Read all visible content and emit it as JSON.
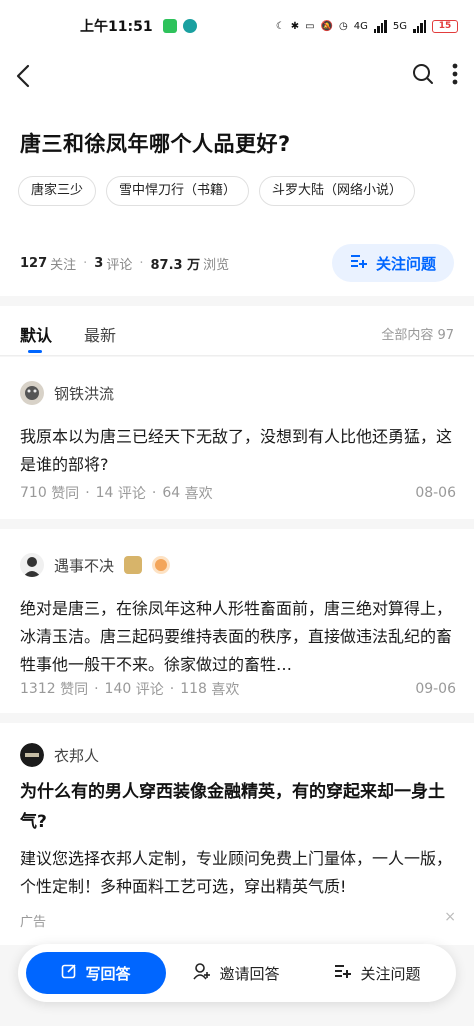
{
  "status": {
    "time": "上午11:51",
    "network_left": "4G",
    "network_right": "5G",
    "battery": "15"
  },
  "question": {
    "title": "唐三和徐凤年哪个人品更好?",
    "tags": [
      "唐家三少",
      "雪中悍刀行（书籍）",
      "斗罗大陆（网络小说）"
    ],
    "followers": "127",
    "followers_label": "关注",
    "comments": "3",
    "comments_label": "评论",
    "views": "87.3 万",
    "views_label": "浏览",
    "follow_button": "关注问题"
  },
  "tabs": {
    "default": "默认",
    "latest": "最新",
    "total": "全部内容 97"
  },
  "answers": [
    {
      "author": "钢铁洪流",
      "text": "我原本以为唐三已经天下无敌了，没想到有人比他还勇猛，这是谁的部将?",
      "likes": "710",
      "likes_label": "赞同",
      "comments": "14",
      "comments_label": "评论",
      "favs": "64",
      "favs_label": "喜欢",
      "date": "08-06"
    },
    {
      "author": "遇事不决",
      "text": "绝对是唐三，在徐凤年这种人形牲畜面前，唐三绝对算得上，冰清玉洁。唐三起码要维持表面的秩序，直接做违法乱纪的畜牲事他一般干不来。徐家做过的畜牲…",
      "likes": "1312",
      "likes_label": "赞同",
      "comments": "140",
      "comments_label": "评论",
      "favs": "118",
      "favs_label": "喜欢",
      "date": "09-06"
    }
  ],
  "ad": {
    "brand": "衣邦人",
    "title": "为什么有的男人穿西装像金融精英，有的穿起来却一身土气?",
    "text": "建议您选择衣邦人定制，专业顾问免费上门量体，一人一版，个性定制！多种面料工艺可选，穿出精英气质!",
    "label": "广告",
    "close": "×"
  },
  "bottom_bar": {
    "write": "写回答",
    "invite": "邀请回答",
    "follow": "关注问题"
  },
  "colors": {
    "accent": "#0066ff",
    "accent_light": "#eaf2ff",
    "battery": "#e23c3c"
  }
}
